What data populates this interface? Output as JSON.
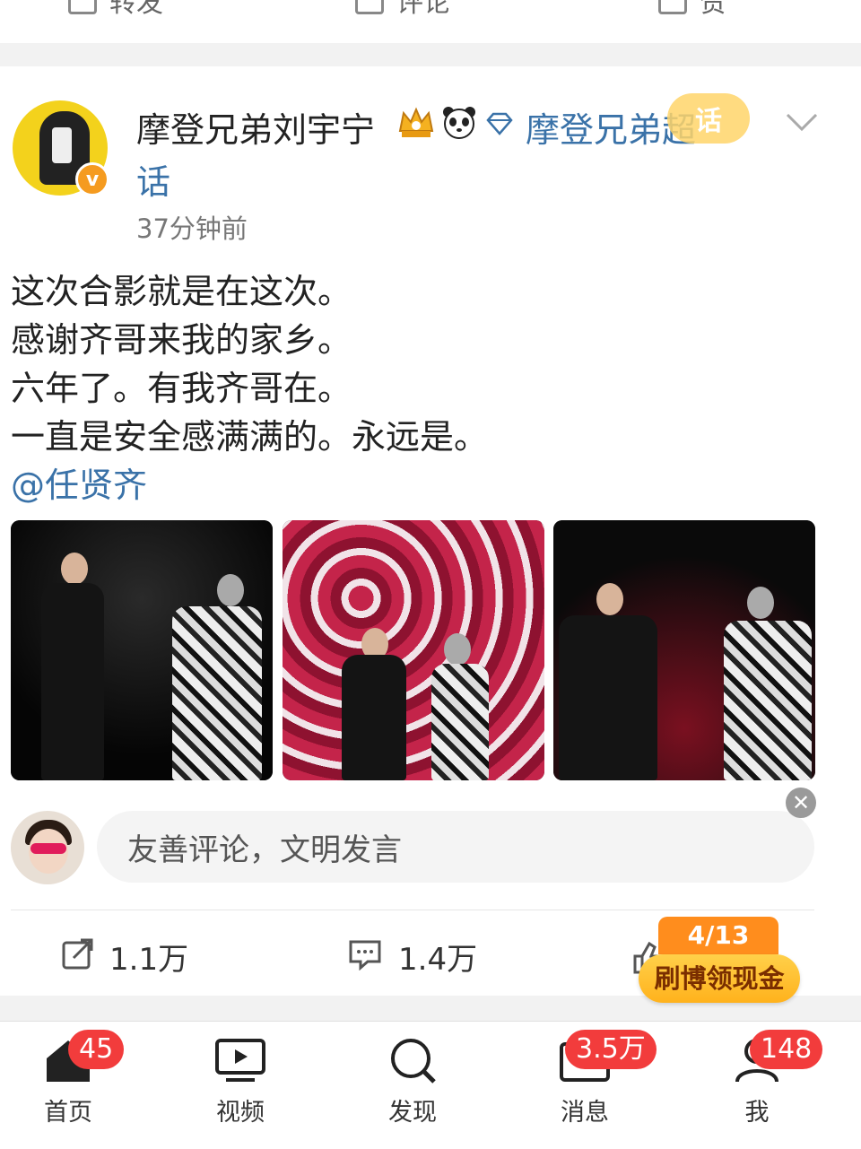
{
  "prev_post": {
    "repost_label": "转发",
    "comment_label": "评论",
    "like_label": "赞"
  },
  "post": {
    "username": "摩登兄弟刘宇宁",
    "topic_part1": "摩登兄弟超",
    "topic_part2": "话",
    "topic_badge": "话",
    "verified_badge": "v",
    "timestamp": "37分钟前",
    "lines": [
      "这次合影就是在这次。",
      "感谢齐哥来我的家乡。",
      "六年了。有我齐哥在。",
      "一直是安全感满满的。永远是。"
    ],
    "mention": "@任贤齐",
    "icons": [
      "crown-icon",
      "panda-icon",
      "diamond-icon",
      "chevron-down-icon"
    ]
  },
  "comment": {
    "placeholder": "友善评论，文明发言"
  },
  "actions": {
    "repost_count": "1.1万",
    "comment_count": "1.4万"
  },
  "promo": {
    "progress": "4/13",
    "label": "刷博领现金"
  },
  "nav": {
    "home": {
      "label": "首页",
      "badge": "45"
    },
    "video": {
      "label": "视频"
    },
    "discover": {
      "label": "发现"
    },
    "messages": {
      "label": "消息",
      "badge": "3.5万"
    },
    "me": {
      "label": "我",
      "badge": "148"
    }
  },
  "colors": {
    "link": "#3a72a8",
    "badge_red": "#f23c3c",
    "promo_orange": "#ff8d1d"
  }
}
